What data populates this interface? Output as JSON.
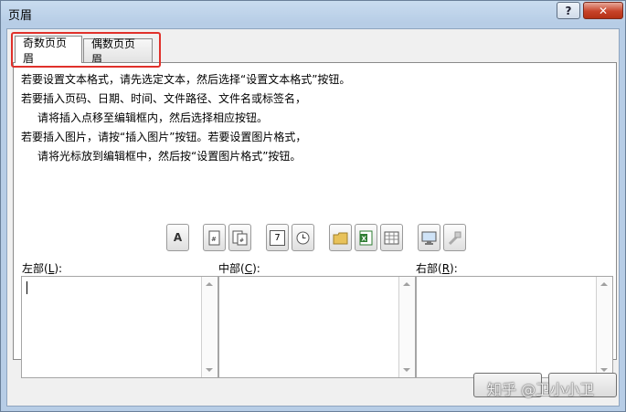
{
  "window": {
    "title": "页眉",
    "help_label": "?",
    "close_label": "✕"
  },
  "tabs": [
    {
      "label": "奇数页页眉",
      "active": true
    },
    {
      "label": "偶数页页眉",
      "active": false
    }
  ],
  "highlight_color": "#e0312b",
  "instructions": [
    "若要设置文本格式，请先选定文本，然后选择“设置文本格式”按钮。",
    "若要插入页码、日期、时间、文件路径、文件名或标签名，",
    "请将插入点移至编辑框内，然后选择相应按钮。",
    "若要插入图片，请按“插入图片”按钮。若要设置图片格式，",
    "请将光标放到编辑框中，然后按“设置图片格式”按钮。"
  ],
  "toolbar": [
    {
      "icon": "format-text-icon",
      "glyph": "A"
    },
    {
      "icon": "insert-page-number-icon"
    },
    {
      "icon": "insert-total-pages-icon"
    },
    {
      "icon": "insert-date-icon",
      "glyph": "7"
    },
    {
      "icon": "insert-time-icon"
    },
    {
      "icon": "insert-file-path-icon"
    },
    {
      "icon": "insert-file-name-icon"
    },
    {
      "icon": "insert-sheet-name-icon"
    },
    {
      "icon": "insert-picture-icon"
    },
    {
      "icon": "format-picture-icon"
    }
  ],
  "sections": {
    "left": {
      "label": "左部(",
      "hotkey": "L",
      "suffix": "):"
    },
    "center": {
      "label": "中部(",
      "hotkey": "C",
      "suffix": "):"
    },
    "right": {
      "label": "右部(",
      "hotkey": "R",
      "suffix": "):"
    }
  },
  "buttons": {
    "ok": "",
    "cancel": ""
  },
  "watermark": "知乎 @卫小小卫"
}
